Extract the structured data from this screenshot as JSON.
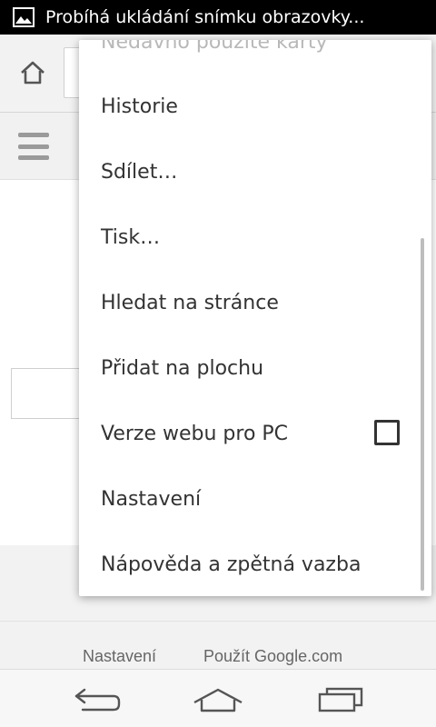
{
  "status_bar": {
    "notification_icon": "image-icon",
    "text": "Probíhá ukládání snímku obrazovky..."
  },
  "toolbar": {
    "home_icon": "home-icon"
  },
  "page": {
    "menu_icon": "hamburger-icon",
    "footer": {
      "settings_link": "Nastavení",
      "use_google_link": "Použít Google.com"
    }
  },
  "menu": {
    "partial_item": "Nedávno použité karty",
    "items": [
      "Historie",
      "Sdílet…",
      "Tisk…",
      "Hledat na stránce",
      "Přidat na plochu",
      "Verze webu pro PC",
      "Nastavení",
      "Nápověda a zpětná vazba"
    ],
    "desktop_site_checked": false
  },
  "nav_bar": {
    "back_icon": "back-icon",
    "home_icon": "home-icon",
    "recent_icon": "recent-apps-icon"
  }
}
